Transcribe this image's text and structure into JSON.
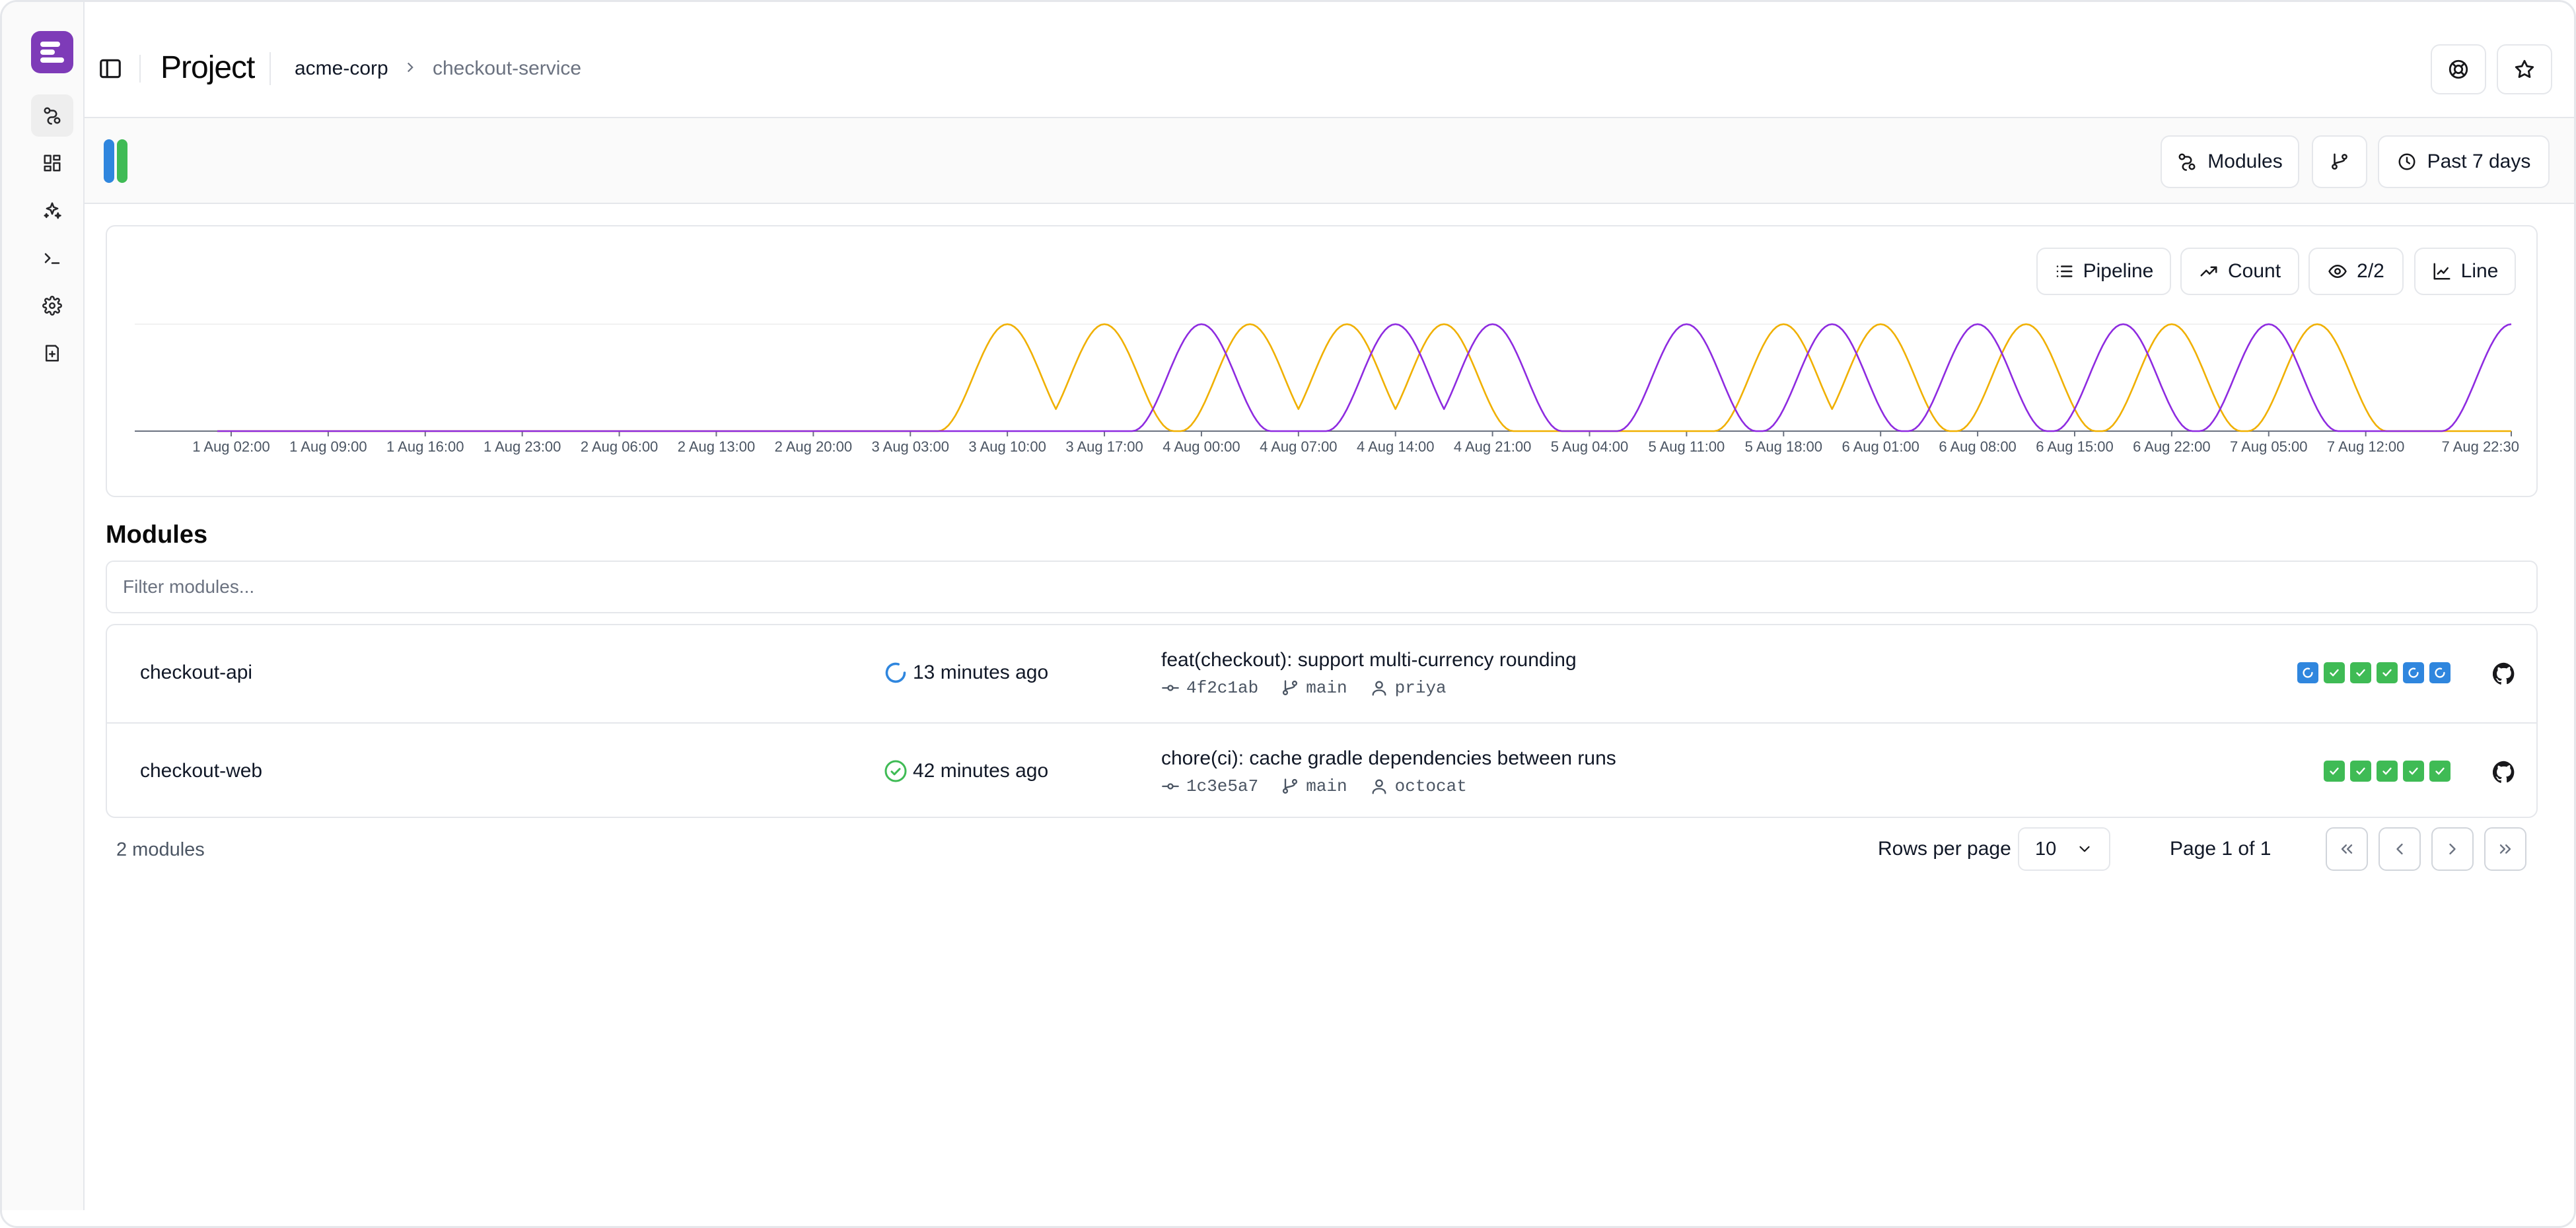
{
  "header": {
    "title": "Project",
    "breadcrumb": {
      "org": "acme-corp",
      "service": "checkout-service"
    },
    "icons": [
      "sidebar-toggle-icon",
      "chevron-right-icon",
      "support-icon",
      "star-icon"
    ]
  },
  "sidebar": {
    "items": [
      {
        "name": "modules",
        "icon": "route-icon",
        "active": true
      },
      {
        "name": "dashboard",
        "icon": "dashboard-icon"
      },
      {
        "name": "insights",
        "icon": "sparkles-icon"
      },
      {
        "name": "terminal",
        "icon": "terminal-icon"
      },
      {
        "name": "settings",
        "icon": "gear-icon"
      },
      {
        "name": "docs",
        "icon": "book-icon"
      }
    ],
    "brand_color": "#7e3bb8"
  },
  "toolbar": {
    "modules_label": "Modules",
    "range_label": "Past 7 days",
    "accent_colors": [
      "#2f86de",
      "#3fbb55"
    ]
  },
  "chart_controls": {
    "group_label": "Pipeline",
    "metric_label": "Count",
    "visible_label": "2/2",
    "type_label": "Line"
  },
  "chart_data": {
    "type": "line",
    "x_ticks": [
      "1 Aug 02:00",
      "1 Aug 09:00",
      "1 Aug 16:00",
      "1 Aug 23:00",
      "2 Aug 06:00",
      "2 Aug 13:00",
      "2 Aug 20:00",
      "3 Aug 03:00",
      "3 Aug 10:00",
      "3 Aug 17:00",
      "4 Aug 00:00",
      "4 Aug 07:00",
      "4 Aug 14:00",
      "4 Aug 21:00",
      "5 Aug 04:00",
      "5 Aug 11:00",
      "5 Aug 18:00",
      "6 Aug 01:00",
      "6 Aug 08:00",
      "6 Aug 15:00",
      "6 Aug 22:00",
      "7 Aug 05:00",
      "7 Aug 12:00",
      "7 Aug 22:30"
    ],
    "series": [
      {
        "color": "#f0b000",
        "peaks": [
          "3 Aug 10:00",
          "3 Aug 17:00",
          "4 Aug 03:30",
          "4 Aug 10:30",
          "4 Aug 17:30",
          "5 Aug 18:00",
          "6 Aug 01:00",
          "6 Aug 11:30",
          "6 Aug 22:00",
          "7 Aug 08:30"
        ]
      },
      {
        "color": "#8e2be0",
        "peaks": [
          "4 Aug 00:00",
          "4 Aug 14:00",
          "4 Aug 21:00",
          "5 Aug 11:00",
          "5 Aug 21:30",
          "6 Aug 08:00",
          "6 Aug 18:30",
          "7 Aug 05:00",
          "7 Aug 22:30"
        ]
      }
    ],
    "ylim": [
      0,
      1
    ],
    "grid": true
  },
  "modules": {
    "title": "Modules",
    "filter_placeholder": "Filter modules...",
    "rows": [
      {
        "name": "checkout-api",
        "status": "running",
        "time": "13 minutes ago",
        "message": "feat(checkout): support multi-currency rounding",
        "commit": "4f2c1ab",
        "branch": "main",
        "author": "priya",
        "runs": [
          "running",
          "success",
          "success",
          "success",
          "running",
          "running"
        ]
      },
      {
        "name": "checkout-web",
        "status": "success",
        "time": "42 minutes ago",
        "message": "chore(ci): cache gradle dependencies between runs",
        "commit": "1c3e5a7",
        "branch": "main",
        "author": "octocat",
        "runs": [
          "success",
          "success",
          "success",
          "success",
          "success"
        ]
      }
    ],
    "status_colors": {
      "success": "#3fbb55",
      "running": "#2f86de"
    }
  },
  "footer": {
    "count": "2 modules",
    "rows_per_page_label": "Rows per page",
    "rows_per_page": "10",
    "page_info": "Page 1 of 1"
  }
}
